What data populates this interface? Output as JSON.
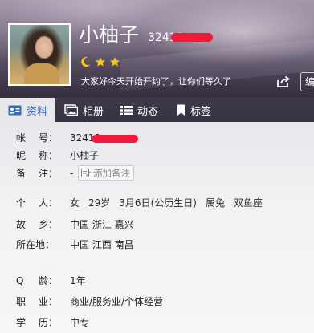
{
  "profile": {
    "nickname": "小柚子",
    "qq_number_visible": "32410",
    "signature": "大家好今天开始开约了，让你们等久了",
    "edit_button_label": "编",
    "level_icons": [
      "moon-icon",
      "star-icon",
      "star-icon"
    ],
    "level_color": "#f5c518"
  },
  "tabs": [
    {
      "label": "资料",
      "icon": "profile-card-icon",
      "active": true
    },
    {
      "label": "相册",
      "icon": "photo-album-icon",
      "active": false
    },
    {
      "label": "动态",
      "icon": "feed-list-icon",
      "active": false
    },
    {
      "label": "标签",
      "icon": "bookmark-icon",
      "active": false
    }
  ],
  "info": {
    "account": {
      "label_chars": [
        "帐",
        "号："
      ],
      "value": "32410"
    },
    "nickname": {
      "label_chars": [
        "昵",
        "称："
      ],
      "value": "小柚子"
    },
    "remark": {
      "label_chars": [
        "备",
        "注："
      ],
      "value": "-",
      "add_label": "添加备注"
    },
    "personal": {
      "label_chars": [
        "个",
        "人："
      ],
      "gender": "女",
      "age": "29岁",
      "birthday": "3月6日(公历生日)",
      "zodiac": "属兔",
      "sign": "双鱼座"
    },
    "hometown": {
      "label_chars": [
        "故",
        "乡："
      ],
      "value": "中国 浙江 嘉兴"
    },
    "location": {
      "label_chars": [
        "所在地："
      ],
      "value": "中国 江西 南昌"
    },
    "qq_age": {
      "label_chars": [
        "Q",
        "龄："
      ],
      "value": "1年"
    },
    "occupation": {
      "label_chars": [
        "职",
        "业："
      ],
      "value": "商业/服务业/个体经营"
    },
    "education": {
      "label_chars": [
        "学",
        "历："
      ],
      "value": "中专"
    }
  },
  "colors": {
    "tab_bar": "#3a3543",
    "active_tab_text": "#3a6cb8",
    "redaction": "#f21a3a"
  }
}
